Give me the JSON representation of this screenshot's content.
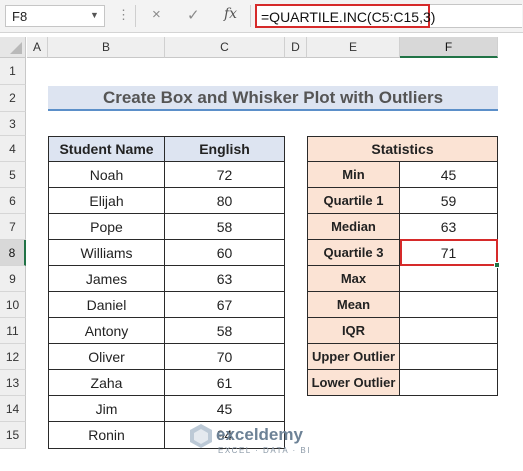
{
  "formula_bar": {
    "name_box": "F8",
    "formula": "=QUARTILE.INC(C5:C15,3)",
    "cancel_icon": "×",
    "enter_icon": "✓",
    "fx_label": "fx"
  },
  "columns": [
    "A",
    "B",
    "C",
    "D",
    "E",
    "F"
  ],
  "rows": [
    "1",
    "2",
    "3",
    "4",
    "5",
    "6",
    "7",
    "8",
    "9",
    "10",
    "11",
    "12",
    "13",
    "14",
    "15"
  ],
  "selected_cell": "F8",
  "title": "Create Box and Whisker Plot with Outliers",
  "students_table": {
    "headers": [
      "Student Name",
      "English"
    ],
    "rows": [
      [
        "Noah",
        "72"
      ],
      [
        "Elijah",
        "80"
      ],
      [
        "Pope",
        "58"
      ],
      [
        "Williams",
        "60"
      ],
      [
        "James",
        "63"
      ],
      [
        "Daniel",
        "67"
      ],
      [
        "Antony",
        "58"
      ],
      [
        "Oliver",
        "70"
      ],
      [
        "Zaha",
        "61"
      ],
      [
        "Jim",
        "45"
      ],
      [
        "Ronin",
        "94"
      ]
    ]
  },
  "statistics_table": {
    "header": "Statistics",
    "rows": [
      [
        "Min",
        "45"
      ],
      [
        "Quartile 1",
        "59"
      ],
      [
        "Median",
        "63"
      ],
      [
        "Quartile 3",
        "71"
      ],
      [
        "Max",
        ""
      ],
      [
        "Mean",
        ""
      ],
      [
        "IQR",
        ""
      ],
      [
        "Upper Outlier",
        ""
      ],
      [
        "Lower Outlier",
        ""
      ]
    ]
  },
  "watermark": {
    "name": "exceldemy",
    "tagline": "EXCEL · DATA · BI"
  },
  "colors": {
    "header_blue": "#dde4f1",
    "stats_peach": "#fbe3d4",
    "selection_red": "#d62a2a",
    "excel_green": "#217346"
  }
}
